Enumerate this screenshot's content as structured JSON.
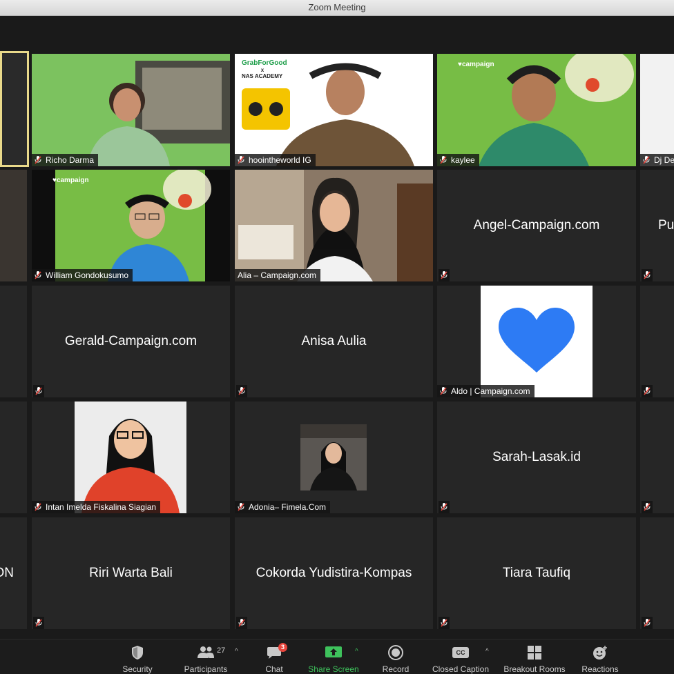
{
  "window": {
    "title": "Zoom Meeting"
  },
  "tiles": {
    "richo": "Richo Darma",
    "hooi": "hoointheworld IG",
    "kaylee": "kaylee",
    "dj": "Dj De",
    "william": "William Gondokusumo",
    "alia": "Alia – Campaign.com",
    "angel": "Angel-Campaign.com",
    "pu": "Pu",
    "gerald": "Gerald-Campaign.com",
    "anisa": "Anisa Aulia",
    "aldo": "Aldo | Campaign.com",
    "intan": "Intan Imelda Fiskalina Siagian",
    "adonia": "Adonia– Fimela.Com",
    "sarah": "Sarah-Lasak.id",
    "on": "ON",
    "riri": "Riri Warta Bali",
    "cokorda": "Cokorda Yudistira-Kompas",
    "tiara": "Tiara Taufiq"
  },
  "logos": {
    "campaign": "♥campaign",
    "grab": "GrabForGood",
    "x": "x",
    "nas": "NAS ACADEMY"
  },
  "toolbar": {
    "security": "Security",
    "participants": "Participants",
    "participants_count": "27",
    "chat": "Chat",
    "chat_badge": "3",
    "share": "Share Screen",
    "record": "Record",
    "cc": "Closed Caption",
    "cc_icon": "CC",
    "breakout": "Breakout Rooms",
    "reactions": "Reactions"
  },
  "colors": {
    "share_green": "#3ec25c",
    "heart_blue": "#2d7bf4",
    "mute_red": "#e8453c",
    "active_speaker": "#e9d98a"
  }
}
